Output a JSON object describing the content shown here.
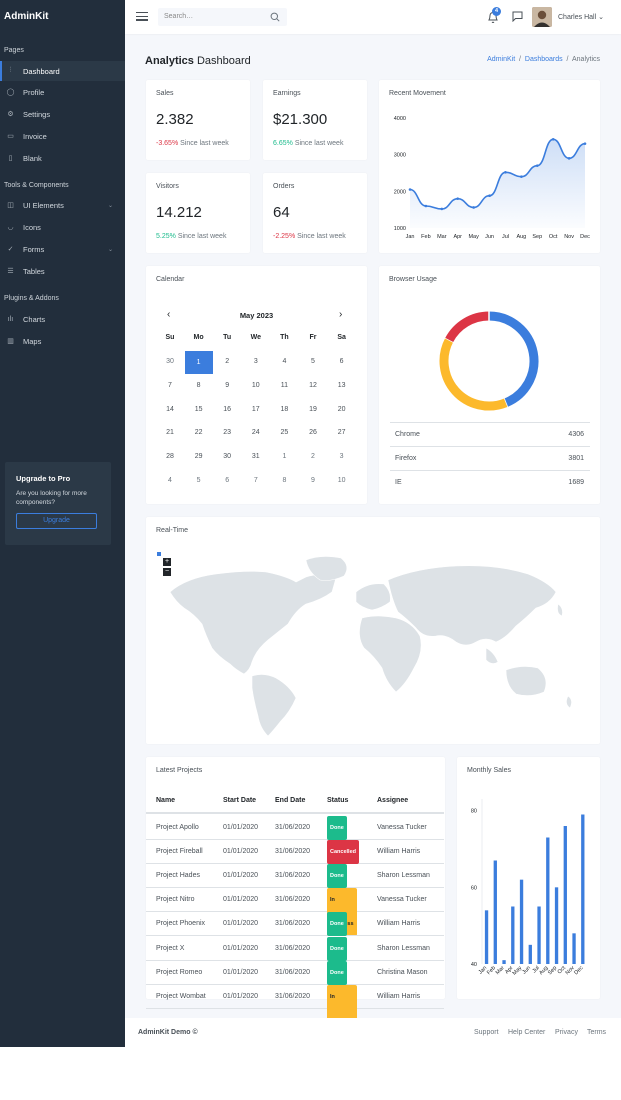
{
  "brand": "AdminKit",
  "sidebar": {
    "headers": [
      "Pages",
      "Tools & Components",
      "Plugins & Addons"
    ],
    "items": [
      {
        "label": "Dashboard",
        "icon": "sliders-icon"
      },
      {
        "label": "Profile",
        "icon": "user-icon"
      },
      {
        "label": "Settings",
        "icon": "gear-icon"
      },
      {
        "label": "Invoice",
        "icon": "credit-card-icon"
      },
      {
        "label": "Blank",
        "icon": "book-icon"
      },
      {
        "label": "UI Elements",
        "icon": "briefcase-icon"
      },
      {
        "label": "Icons",
        "icon": "coffee-icon"
      },
      {
        "label": "Forms",
        "icon": "check-circle-icon"
      },
      {
        "label": "Tables",
        "icon": "list-icon"
      },
      {
        "label": "Charts",
        "icon": "bar-chart-icon"
      },
      {
        "label": "Maps",
        "icon": "map-icon"
      }
    ],
    "promo": {
      "title": "Upgrade to Pro",
      "text": "Are you looking for more components?",
      "button": "Upgrade"
    }
  },
  "topbar": {
    "search_placeholder": "Search…",
    "notif_count": "4",
    "user": "Charles Hall"
  },
  "page": {
    "title_bold": "Analytics",
    "title_rest": "Dashboard",
    "crumbs": [
      "AdminKit",
      "Dashboards",
      "Analytics"
    ]
  },
  "stats": [
    {
      "title": "Sales",
      "value": "2.382",
      "change": "-3.65%",
      "note": "Since last week",
      "trend": "negative"
    },
    {
      "title": "Earnings",
      "value": "$21.300",
      "change": "6.65%",
      "note": "Since last week",
      "trend": "positive"
    },
    {
      "title": "Visitors",
      "value": "14.212",
      "change": "5.25%",
      "note": "Since last week",
      "trend": "positive"
    },
    {
      "title": "Orders",
      "value": "64",
      "change": "-2.25%",
      "note": "Since last week",
      "trend": "negative"
    }
  ],
  "recent_movement": {
    "title": "Recent Movement"
  },
  "calendar": {
    "title": "Calendar",
    "month": "May 2023",
    "days": [
      "Su",
      "Mo",
      "Tu",
      "We",
      "Th",
      "Fr",
      "Sa"
    ],
    "weeks": [
      [
        "30",
        "1",
        "2",
        "3",
        "4",
        "5",
        "6"
      ],
      [
        "7",
        "8",
        "9",
        "10",
        "11",
        "12",
        "13"
      ],
      [
        "14",
        "15",
        "16",
        "17",
        "18",
        "19",
        "20"
      ],
      [
        "21",
        "22",
        "23",
        "24",
        "25",
        "26",
        "27"
      ],
      [
        "28",
        "29",
        "30",
        "31",
        "1",
        "2",
        "3"
      ],
      [
        "4",
        "5",
        "6",
        "7",
        "8",
        "9",
        "10"
      ]
    ],
    "selected": "1"
  },
  "browser_usage": {
    "title": "Browser Usage",
    "rows": [
      {
        "name": "Chrome",
        "value": "4306"
      },
      {
        "name": "Firefox",
        "value": "3801"
      },
      {
        "name": "IE",
        "value": "1689"
      }
    ]
  },
  "realtime": {
    "title": "Real-Time",
    "zoom_in": "+",
    "zoom_out": "−"
  },
  "projects": {
    "title": "Latest Projects",
    "columns": [
      "Name",
      "Start Date",
      "End Date",
      "Status",
      "Assignee"
    ],
    "rows": [
      {
        "name": "Project Apollo",
        "start": "01/01/2020",
        "end": "31/06/2020",
        "status": "Done",
        "assignee": "Vanessa Tucker"
      },
      {
        "name": "Project Fireball",
        "start": "01/01/2020",
        "end": "31/06/2020",
        "status": "Cancelled",
        "assignee": "William Harris"
      },
      {
        "name": "Project Hades",
        "start": "01/01/2020",
        "end": "31/06/2020",
        "status": "Done",
        "assignee": "Sharon Lessman"
      },
      {
        "name": "Project Nitro",
        "start": "01/01/2020",
        "end": "31/06/2020",
        "status": "In progress",
        "assignee": "Vanessa Tucker"
      },
      {
        "name": "Project Phoenix",
        "start": "01/01/2020",
        "end": "31/06/2020",
        "status": "Done",
        "assignee": "William Harris"
      },
      {
        "name": "Project X",
        "start": "01/01/2020",
        "end": "31/06/2020",
        "status": "Done",
        "assignee": "Sharon Lessman"
      },
      {
        "name": "Project Romeo",
        "start": "01/01/2020",
        "end": "31/06/2020",
        "status": "Done",
        "assignee": "Christina Mason"
      },
      {
        "name": "Project Wombat",
        "start": "01/01/2020",
        "end": "31/06/2020",
        "status": "In progress",
        "assignee": "William Harris"
      }
    ]
  },
  "monthly_sales": {
    "title": "Monthly Sales"
  },
  "footer": {
    "left": "AdminKit Demo ©",
    "links": [
      "Support",
      "Help Center",
      "Privacy",
      "Terms"
    ]
  },
  "chart_data": [
    {
      "type": "area",
      "categories": [
        "Jan",
        "Feb",
        "Mar",
        "Apr",
        "May",
        "Jun",
        "Jul",
        "Aug",
        "Sep",
        "Oct",
        "Nov",
        "Dec"
      ],
      "series": [
        {
          "values": [
            2050,
            1600,
            1520,
            1800,
            1560,
            1880,
            2520,
            2400,
            2700,
            3420,
            2900,
            3300
          ]
        }
      ],
      "ylim": [
        1000,
        4000
      ],
      "yticks": [
        1000,
        2000,
        3000,
        4000
      ],
      "color": "#3b7ddd"
    },
    {
      "type": "pie",
      "categories": [
        "Chrome",
        "Firefox",
        "IE"
      ],
      "values": [
        4306,
        3801,
        1689
      ],
      "colors": [
        "#3b7ddd",
        "#fcb92c",
        "#dc3545"
      ],
      "donut": true
    },
    {
      "type": "bar",
      "categories": [
        "Jan",
        "Feb",
        "Mar",
        "Apr",
        "May",
        "Jun",
        "Jul",
        "Aug",
        "Sep",
        "Oct",
        "Nov",
        "Dec"
      ],
      "values": [
        54,
        67,
        41,
        55,
        62,
        45,
        55,
        73,
        60,
        76,
        48,
        79
      ],
      "ylim": [
        40,
        82
      ],
      "yticks": [
        40,
        60,
        80
      ],
      "color": "#3b7ddd"
    }
  ]
}
